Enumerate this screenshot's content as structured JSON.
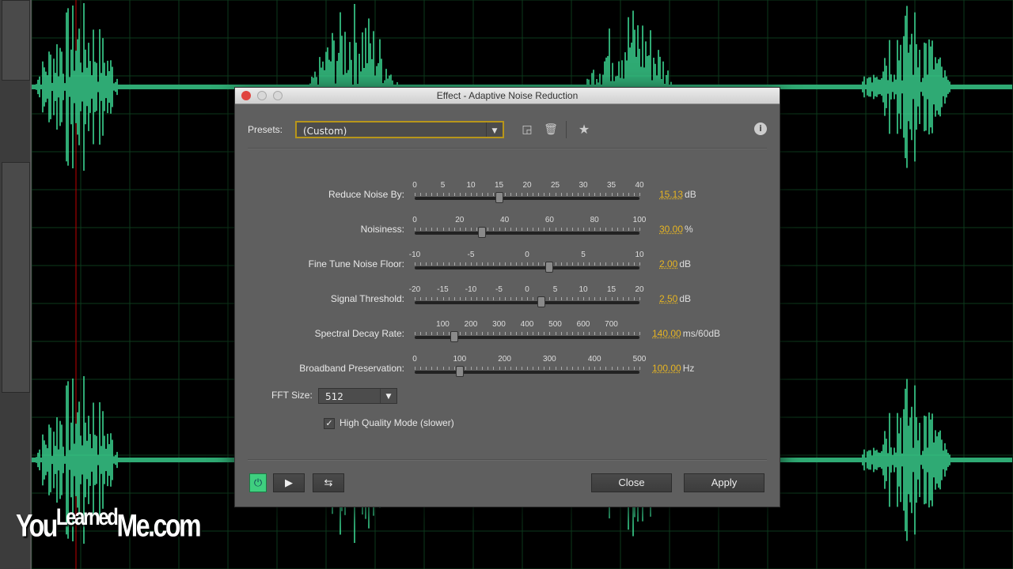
{
  "dialog": {
    "title": "Effect - Adaptive Noise Reduction",
    "presets_label": "Presets:",
    "preset_value": "(Custom)",
    "icons": [
      "save-preset-icon",
      "delete-preset-icon",
      "favorite-star-icon",
      "info-icon"
    ]
  },
  "sliders": [
    {
      "label": "Reduce Noise By:",
      "ticks": [
        "0",
        "5",
        "10",
        "15",
        "20",
        "25",
        "30",
        "35",
        "40"
      ],
      "min": 0,
      "max": 40,
      "value": 15.13,
      "display": "15.13",
      "unit": "dB"
    },
    {
      "label": "Noisiness:",
      "ticks": [
        "0",
        "20",
        "40",
        "60",
        "80",
        "100"
      ],
      "min": 0,
      "max": 100,
      "value": 30,
      "display": "30.00",
      "unit": "%"
    },
    {
      "label": "Fine Tune Noise Floor:",
      "ticks": [
        "-10",
        "-5",
        "0",
        "5",
        "10"
      ],
      "min": -10,
      "max": 10,
      "value": 2,
      "display": "2.00",
      "unit": "dB"
    },
    {
      "label": "Signal Threshold:",
      "ticks": [
        "-20",
        "-15",
        "-10",
        "-5",
        "0",
        "5",
        "10",
        "15",
        "20"
      ],
      "min": -20,
      "max": 20,
      "value": 2.5,
      "display": "2.50",
      "unit": "dB"
    },
    {
      "label": "Spectral Decay Rate:",
      "ticks": [
        "100",
        "200",
        "300",
        "400",
        "500",
        "600",
        "700"
      ],
      "tick_values": [
        100,
        200,
        300,
        400,
        500,
        600,
        700
      ],
      "min": 0,
      "max": 800,
      "value": 140,
      "display": "140.00",
      "unit": "ms/60dB"
    },
    {
      "label": "Broadband Preservation:",
      "ticks": [
        "0",
        "100",
        "200",
        "300",
        "400",
        "500"
      ],
      "min": 0,
      "max": 500,
      "value": 100,
      "display": "100.00",
      "unit": "Hz"
    }
  ],
  "fft": {
    "label": "FFT Size:",
    "value": "512"
  },
  "high_quality": {
    "label": "High Quality Mode (slower)",
    "checked": true,
    "mark": "✓"
  },
  "buttons": {
    "close": "Close",
    "apply": "Apply"
  },
  "watermark": {
    "part1": "You",
    "part2": "Learned",
    "part3": "Me.com"
  },
  "colors": {
    "waveform": "#3fe39a",
    "accent": "#e6b422",
    "playhead": "#c00000"
  }
}
